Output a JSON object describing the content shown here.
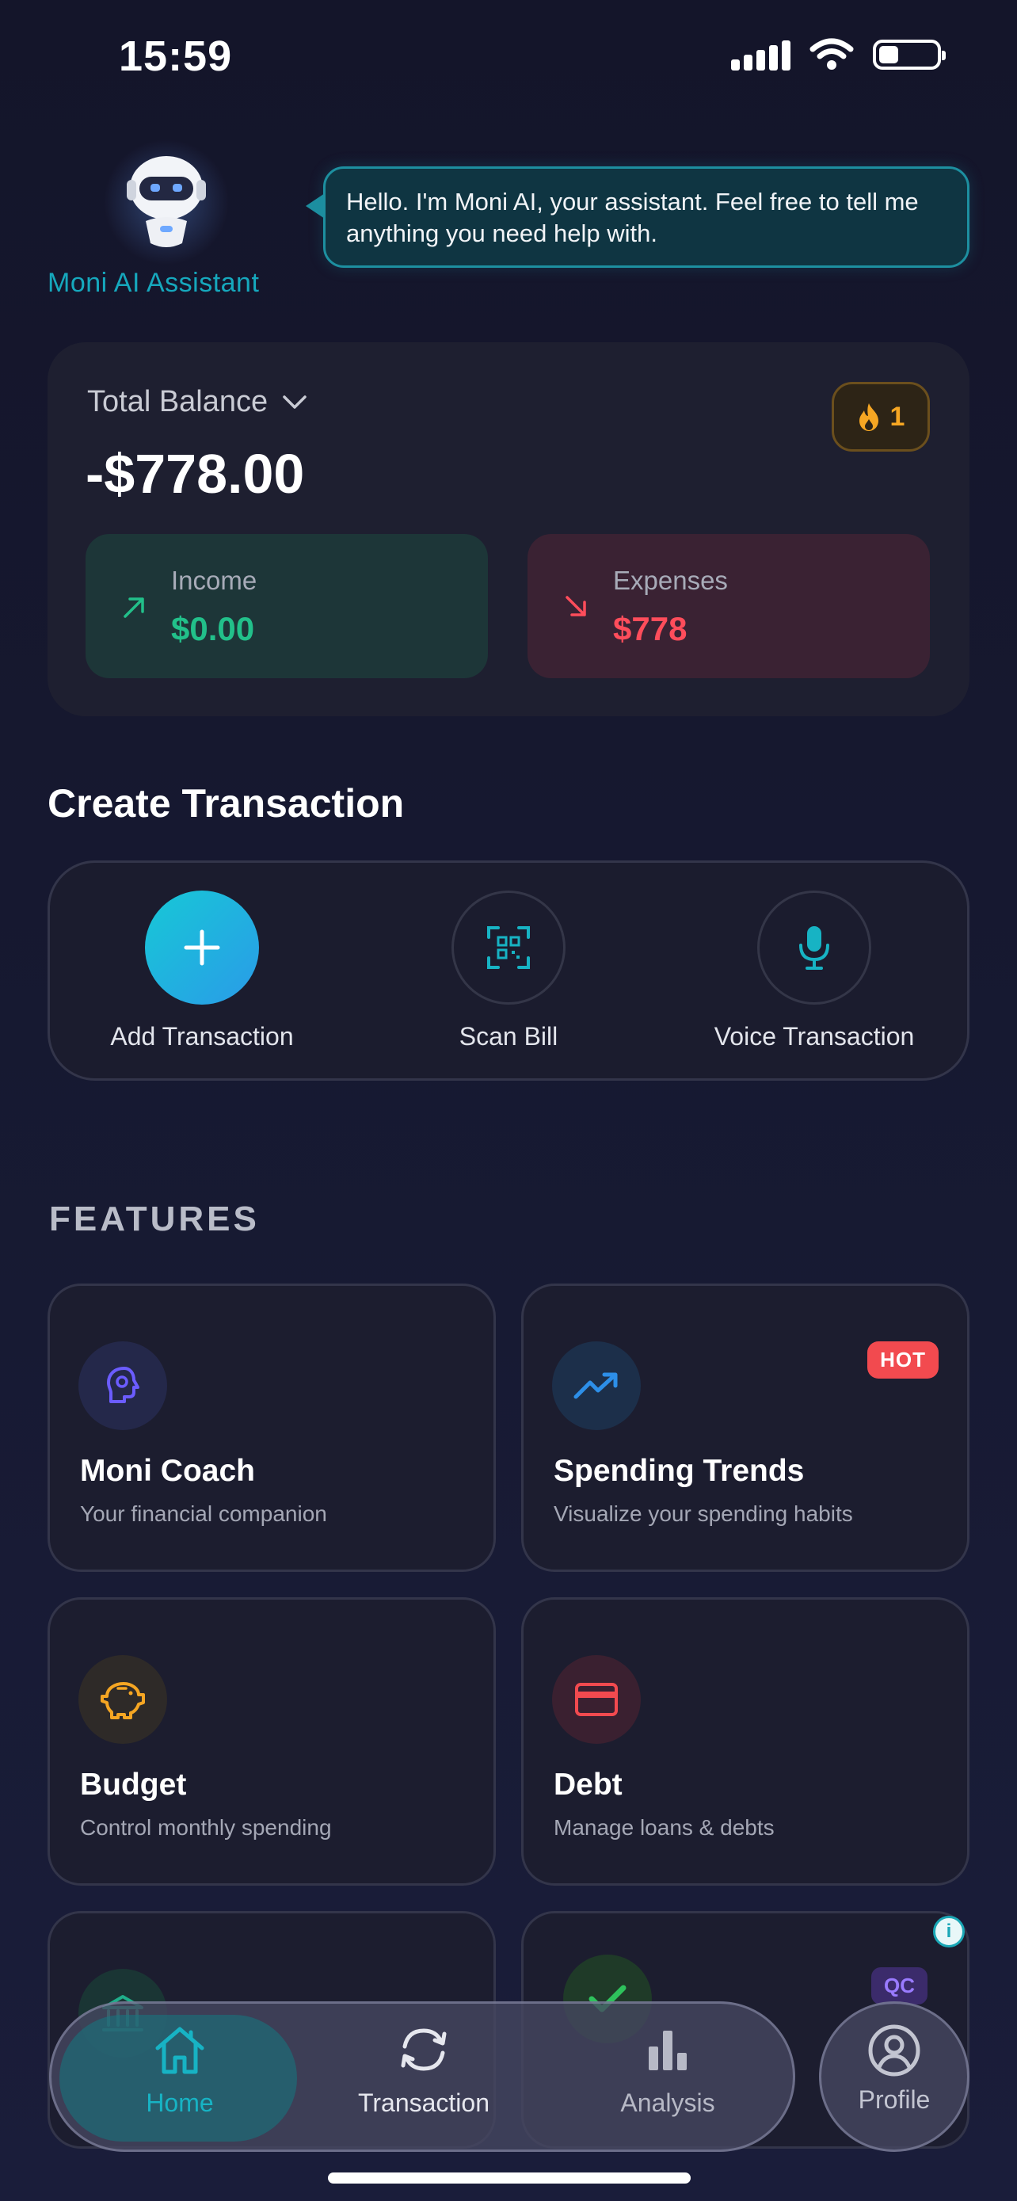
{
  "status_bar": {
    "time": "15:59"
  },
  "assistant": {
    "name": "Moni AI Assistant",
    "message": "Hello. I'm Moni AI, your assistant. Feel free to tell me anything you need help with."
  },
  "balance": {
    "label": "Total Balance",
    "amount": "-$778.00",
    "streak_count": "1",
    "income": {
      "label": "Income",
      "value": "$0.00"
    },
    "expenses": {
      "label": "Expenses",
      "value": "$778"
    }
  },
  "create_transaction": {
    "title": "Create Transaction",
    "actions": [
      {
        "label": "Add Transaction",
        "icon": "plus-icon"
      },
      {
        "label": "Scan Bill",
        "icon": "qr-scan-icon"
      },
      {
        "label": "Voice Transaction",
        "icon": "microphone-icon"
      }
    ]
  },
  "features": {
    "title": "FEATURES",
    "items": [
      {
        "title": "Moni Coach",
        "subtitle": "Your financial companion",
        "icon": "brain-icon",
        "color": "#6b5cff"
      },
      {
        "title": "Spending Trends",
        "subtitle": "Visualize your spending habits",
        "icon": "trend-up-icon",
        "color": "#2d8fe8",
        "badge": "HOT"
      },
      {
        "title": "Budget",
        "subtitle": "Control monthly spending",
        "icon": "piggy-bank-icon",
        "color": "#f5a623"
      },
      {
        "title": "Debt",
        "subtitle": "Manage loans & debts",
        "icon": "credit-card-icon",
        "color": "#f24a4f"
      },
      {
        "title": "",
        "subtitle": "",
        "icon": "bank-icon",
        "color": "#1fae8a"
      },
      {
        "title": "",
        "subtitle": "",
        "icon": "check-icon",
        "color": "#2ec25c",
        "badge": "QC"
      }
    ]
  },
  "nav": {
    "items": [
      {
        "label": "Home",
        "icon": "home-icon",
        "active": true
      },
      {
        "label": "Transaction",
        "icon": "refresh-icon"
      },
      {
        "label": "Analysis",
        "icon": "bar-chart-icon"
      },
      {
        "label": "Profile",
        "icon": "user-circle-icon"
      }
    ]
  },
  "colors": {
    "accent": "#17b3c4",
    "income": "#22c08a",
    "expense": "#ff4d5b",
    "streak": "#f5a623"
  }
}
